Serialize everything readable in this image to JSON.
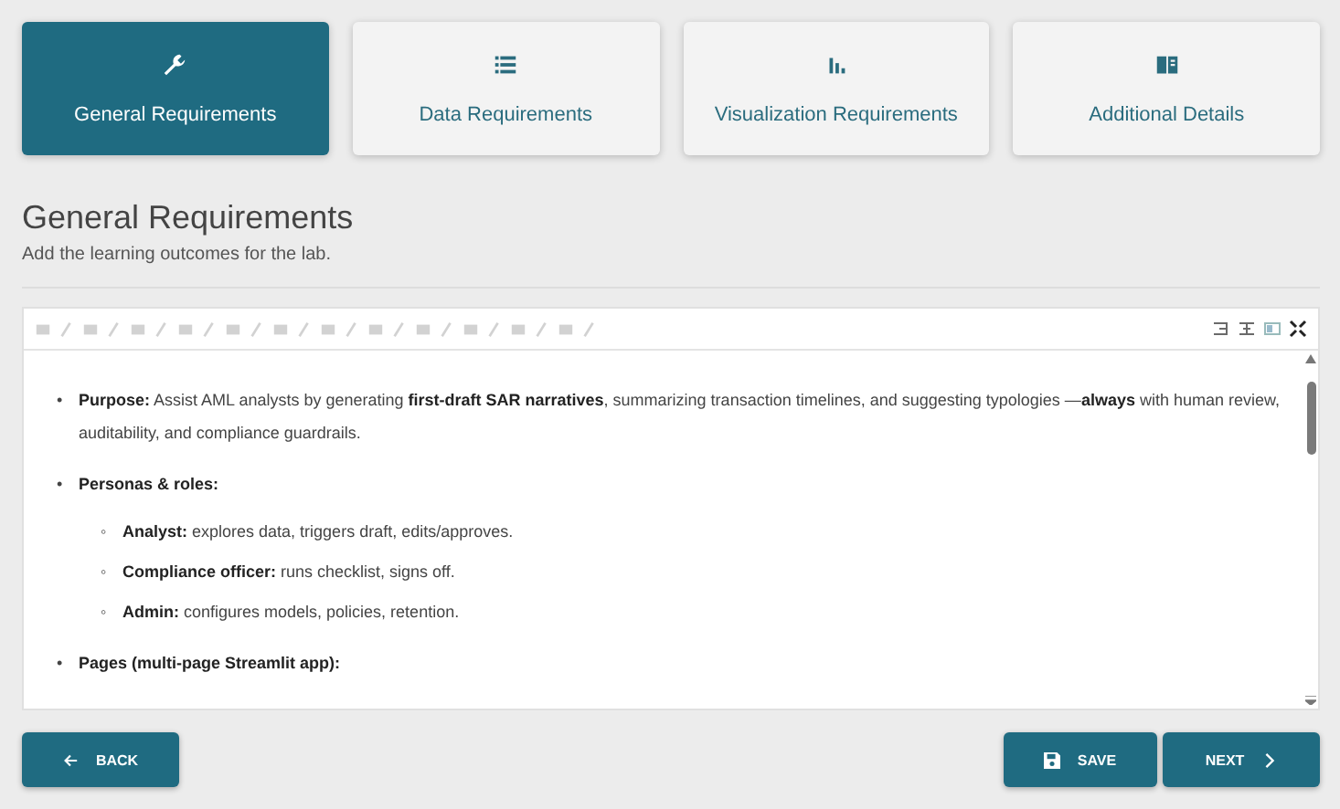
{
  "tabs": [
    {
      "label": "General Requirements",
      "selected": true
    },
    {
      "label": "Data Requirements",
      "selected": false
    },
    {
      "label": "Visualization Requirements",
      "selected": false
    },
    {
      "label": "Additional Details",
      "selected": false
    }
  ],
  "section": {
    "title": "General Requirements",
    "subtitle": "Add the learning outcomes for the lab."
  },
  "editor": {
    "items": [
      {
        "marker": "•",
        "text": "**Purpose:** Assist AML analysts by generating **first-draft SAR narratives**, summarizing transaction timelines, and suggesting typologies —**always** with human review, auditability, and compliance guardrails."
      },
      {
        "marker": "•",
        "text": "**Personas & roles:**",
        "children": [
          {
            "marker": "◦",
            "text": "**Analyst:** explores data, triggers draft, edits/approves."
          },
          {
            "marker": "◦",
            "text": "**Compliance officer:** runs checklist, signs off."
          },
          {
            "marker": "◦",
            "text": "**Admin:** configures models, policies, retention."
          }
        ]
      },
      {
        "marker": "•",
        "text": "**Pages (multi-page Streamlit app):**"
      }
    ]
  },
  "buttons": {
    "back": "BACK",
    "save": "SAVE",
    "next": "NEXT"
  }
}
